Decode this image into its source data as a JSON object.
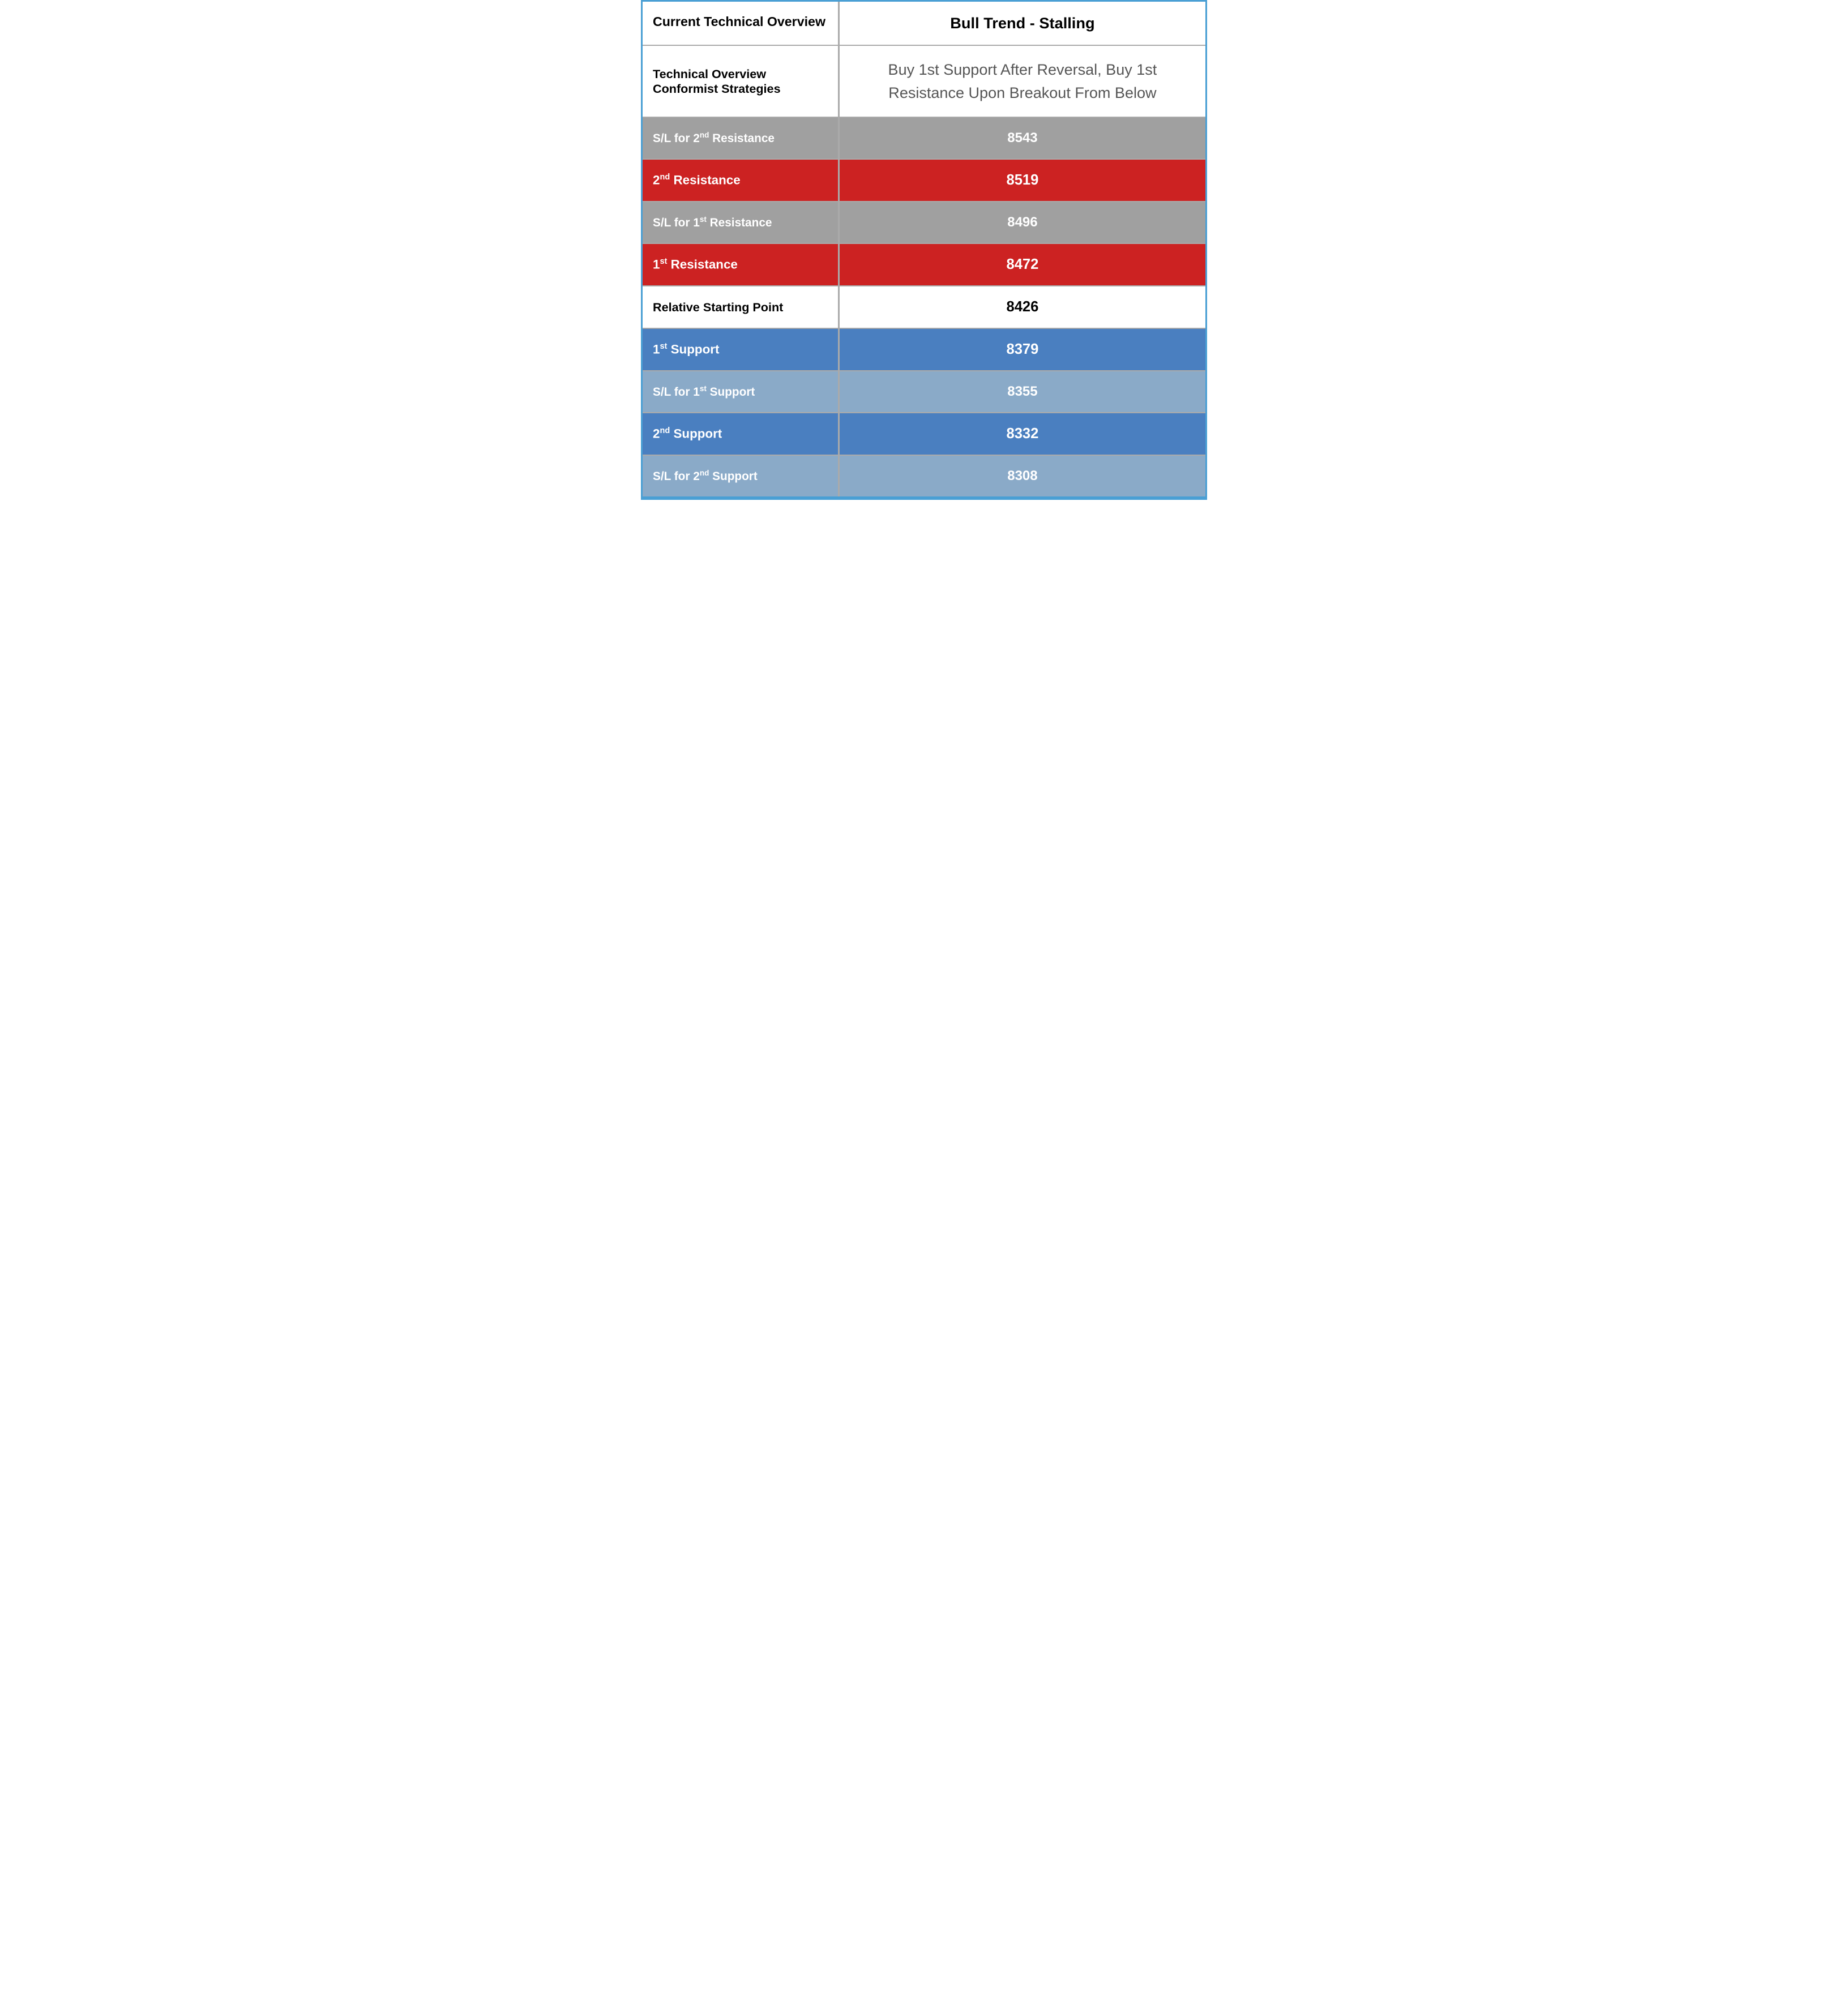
{
  "header": {
    "left_label": "Current Technical Overview",
    "right_label": "Bull Trend - Stalling"
  },
  "strategies": {
    "left_label": "Technical Overview Conformist Strategies",
    "right_text": "Buy 1st Support After Reversal, Buy 1st Resistance Upon Breakout From Below"
  },
  "rows": [
    {
      "id": "sl-2nd-resistance",
      "style": "gray",
      "left": "S/L for 2",
      "left_sup": "nd",
      "left_suffix": " Resistance",
      "right": "8543"
    },
    {
      "id": "2nd-resistance",
      "style": "red",
      "left": "2",
      "left_sup": "nd",
      "left_suffix": " Resistance",
      "right": "8519"
    },
    {
      "id": "sl-1st-resistance",
      "style": "gray",
      "left": "S/L for 1",
      "left_sup": "st",
      "left_suffix": " Resistance",
      "right": "8496"
    },
    {
      "id": "1st-resistance",
      "style": "red",
      "left": "1",
      "left_sup": "st",
      "left_suffix": " Resistance",
      "right": "8472"
    },
    {
      "id": "relative-starting-point",
      "style": "white",
      "left": "Relative Starting Point",
      "right": "8426"
    },
    {
      "id": "1st-support",
      "style": "blue",
      "left": "1",
      "left_sup": "st",
      "left_suffix": " Support",
      "right": "8379"
    },
    {
      "id": "sl-1st-support",
      "style": "bluegray",
      "left": "S/L for 1",
      "left_sup": "st",
      "left_suffix": " Support",
      "right": "8355"
    },
    {
      "id": "2nd-support",
      "style": "blue",
      "left": "2",
      "left_sup": "nd",
      "left_suffix": " Support",
      "right": "8332"
    },
    {
      "id": "sl-2nd-support",
      "style": "bluegray",
      "left": "S/L for 2",
      "left_sup": "nd",
      "left_suffix": " Support",
      "right": "8308"
    }
  ]
}
